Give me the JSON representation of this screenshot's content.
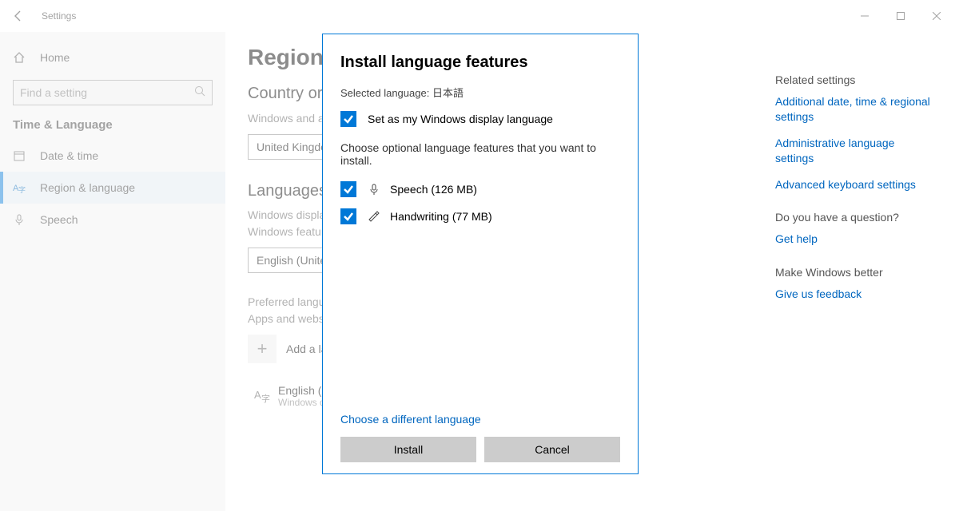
{
  "titlebar": {
    "title": "Settings"
  },
  "sidebar": {
    "home": "Home",
    "search_placeholder": "Find a setting",
    "section": "Time & Language",
    "items": [
      {
        "label": "Date & time"
      },
      {
        "label": "Region & language"
      },
      {
        "label": "Speech"
      }
    ]
  },
  "main": {
    "page_title": "Region & language",
    "country_heading": "Country or region",
    "country_desc": "Windows and apps might use your country or region to give you local content",
    "country_value": "United Kingdom",
    "languages_heading": "Languages",
    "display_label": "Windows display language",
    "display_desc": "Windows features like Settings and File Explorer will appear in this language.",
    "display_value": "English (United States)",
    "preferred_label": "Preferred languages",
    "preferred_desc": "Apps and websites will appear in the first language in the list that they support.",
    "add_label": "Add a language",
    "lang1_primary": "English (United States)",
    "lang1_secondary": "Windows display language"
  },
  "right": {
    "related_heading": "Related settings",
    "link1": "Additional date, time & regional settings",
    "link2": "Administrative language settings",
    "link3": "Advanced keyboard settings",
    "question_heading": "Do you have a question?",
    "help_link": "Get help",
    "better_heading": "Make Windows better",
    "feedback_link": "Give us feedback"
  },
  "modal": {
    "title": "Install language features",
    "selected_prefix": "Selected language: ",
    "selected_lang": "日本語",
    "set_display": "Set as my Windows display language",
    "choose_text": "Choose optional language features that you want to install.",
    "speech": "Speech (126 MB)",
    "handwriting": "Handwriting (77 MB)",
    "diff_lang": "Choose a different language",
    "install": "Install",
    "cancel": "Cancel"
  }
}
